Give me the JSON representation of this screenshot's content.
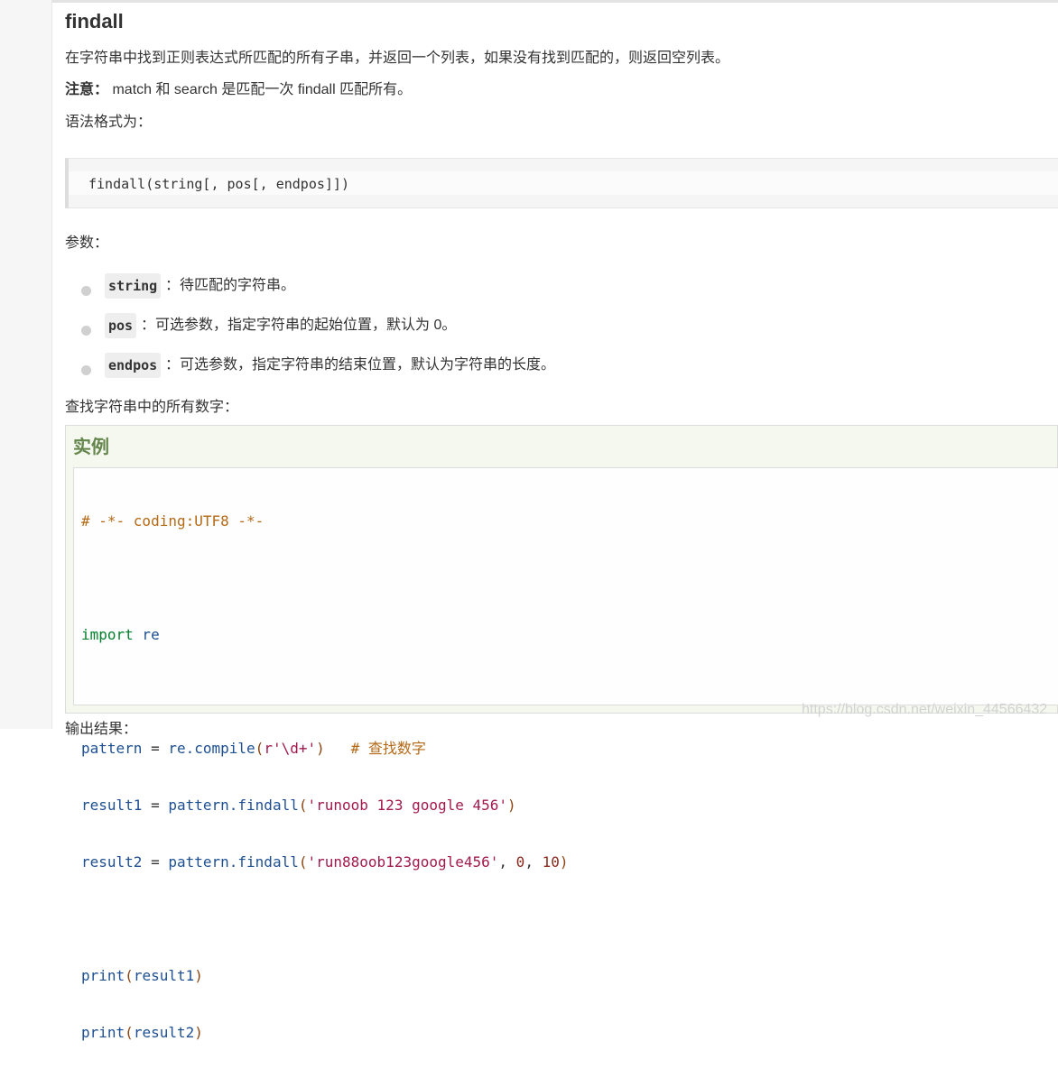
{
  "section": {
    "title": "findall",
    "description": "在字符串中找到正则表达式所匹配的所有子串，并返回一个列表，如果没有找到匹配的，则返回空列表。",
    "note_label": "注意：",
    "note_text": " match 和 search 是匹配一次 findall 匹配所有。",
    "syntax_intro": "语法格式为："
  },
  "syntax": {
    "code": "findall(string[, pos[, endpos]])"
  },
  "params": {
    "heading": "参数：",
    "items": [
      {
        "name": "string",
        "desc": "：待匹配的字符串。"
      },
      {
        "name": "pos",
        "desc": "：可选参数，指定字符串的起始位置，默认为 0。"
      },
      {
        "name": "endpos",
        "desc": "：可选参数，指定字符串的结束位置，默认为字符串的长度。"
      }
    ]
  },
  "example": {
    "intro": "查找字符串中的所有数字：",
    "title": "实例",
    "code": {
      "l1": "# -*- coding:UTF8 -*-",
      "l3_kw": "import",
      "l3_mod": " re",
      "l5_var": "pattern",
      "l5_eq": " = ",
      "l5_call": "re.compile",
      "l5_p1": "(",
      "l5_str": "r'\\d+'",
      "l5_p2": ")",
      "l5_comment": "   # 查找数字",
      "l6_var": "result1",
      "l6_eq": " = ",
      "l6_call": "pattern.findall",
      "l6_p1": "(",
      "l6_str": "'runoob 123 google 456'",
      "l6_p2": ")",
      "l7_var": "result2",
      "l7_eq": " = ",
      "l7_call": "pattern.findall",
      "l7_p1": "(",
      "l7_str": "'run88oob123google456'",
      "l7_sep1": ", ",
      "l7_n1": "0",
      "l7_sep2": ", ",
      "l7_n2": "10",
      "l7_p2": ")",
      "l9_fn": "print",
      "l9_p1": "(",
      "l9_arg": "result1",
      "l9_p2": ")",
      "l10_fn": "print",
      "l10_p1": "(",
      "l10_arg": "result2",
      "l10_p2": ")"
    }
  },
  "watermark": "https://blog.csdn.net/weixin_44566432",
  "cutoff_text": "输出结果："
}
